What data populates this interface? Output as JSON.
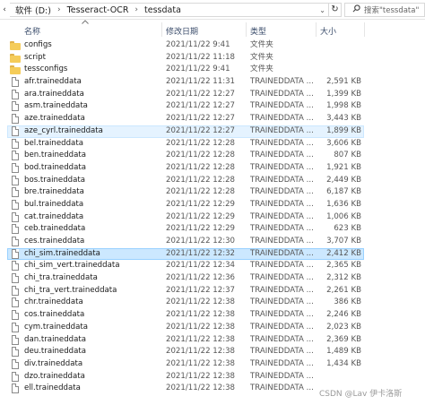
{
  "breadcrumb": {
    "items": [
      "软件 (D:)",
      "Tesseract-OCR",
      "tessdata"
    ],
    "back_arrow": "‹",
    "separator": "›",
    "dropdown": "⌄",
    "refresh_glyph": "↻"
  },
  "search": {
    "placeholder": "搜索\"tessdata\"",
    "icon": "search-icon"
  },
  "columns": {
    "name": "名称",
    "date": "修改日期",
    "type": "类型",
    "size": "大小"
  },
  "files": [
    {
      "name": "configs",
      "date": "2021/11/22 9:41",
      "type": "文件夹",
      "size": "",
      "kind": "folder"
    },
    {
      "name": "script",
      "date": "2021/11/22 11:18",
      "type": "文件夹",
      "size": "",
      "kind": "folder"
    },
    {
      "name": "tessconfigs",
      "date": "2021/11/22 9:41",
      "type": "文件夹",
      "size": "",
      "kind": "folder"
    },
    {
      "name": "afr.traineddata",
      "date": "2021/11/22 11:31",
      "type": "TRAINEDDATA ...",
      "size": "2,591 KB",
      "kind": "file"
    },
    {
      "name": "ara.traineddata",
      "date": "2021/11/22 12:27",
      "type": "TRAINEDDATA ...",
      "size": "1,399 KB",
      "kind": "file"
    },
    {
      "name": "asm.traineddata",
      "date": "2021/11/22 12:27",
      "type": "TRAINEDDATA ...",
      "size": "1,998 KB",
      "kind": "file"
    },
    {
      "name": "aze.traineddata",
      "date": "2021/11/22 12:27",
      "type": "TRAINEDDATA ...",
      "size": "3,443 KB",
      "kind": "file"
    },
    {
      "name": "aze_cyrl.traineddata",
      "date": "2021/11/22 12:27",
      "type": "TRAINEDDATA ...",
      "size": "1,899 KB",
      "kind": "file",
      "state": "hover"
    },
    {
      "name": "bel.traineddata",
      "date": "2021/11/22 12:28",
      "type": "TRAINEDDATA ...",
      "size": "3,606 KB",
      "kind": "file"
    },
    {
      "name": "ben.traineddata",
      "date": "2021/11/22 12:28",
      "type": "TRAINEDDATA ...",
      "size": "807 KB",
      "kind": "file"
    },
    {
      "name": "bod.traineddata",
      "date": "2021/11/22 12:28",
      "type": "TRAINEDDATA ...",
      "size": "1,921 KB",
      "kind": "file"
    },
    {
      "name": "bos.traineddata",
      "date": "2021/11/22 12:28",
      "type": "TRAINEDDATA ...",
      "size": "2,449 KB",
      "kind": "file"
    },
    {
      "name": "bre.traineddata",
      "date": "2021/11/22 12:28",
      "type": "TRAINEDDATA ...",
      "size": "6,187 KB",
      "kind": "file"
    },
    {
      "name": "bul.traineddata",
      "date": "2021/11/22 12:29",
      "type": "TRAINEDDATA ...",
      "size": "1,636 KB",
      "kind": "file"
    },
    {
      "name": "cat.traineddata",
      "date": "2021/11/22 12:29",
      "type": "TRAINEDDATA ...",
      "size": "1,006 KB",
      "kind": "file"
    },
    {
      "name": "ceb.traineddata",
      "date": "2021/11/22 12:29",
      "type": "TRAINEDDATA ...",
      "size": "623 KB",
      "kind": "file"
    },
    {
      "name": "ces.traineddata",
      "date": "2021/11/22 12:30",
      "type": "TRAINEDDATA ...",
      "size": "3,707 KB",
      "kind": "file"
    },
    {
      "name": "chi_sim.traineddata",
      "date": "2021/11/22 12:32",
      "type": "TRAINEDDATA ...",
      "size": "2,412 KB",
      "kind": "file",
      "state": "selected"
    },
    {
      "name": "chi_sim_vert.traineddata",
      "date": "2021/11/22 12:34",
      "type": "TRAINEDDATA ...",
      "size": "2,365 KB",
      "kind": "file"
    },
    {
      "name": "chi_tra.traineddata",
      "date": "2021/11/22 12:36",
      "type": "TRAINEDDATA ...",
      "size": "2,312 KB",
      "kind": "file"
    },
    {
      "name": "chi_tra_vert.traineddata",
      "date": "2021/11/22 12:37",
      "type": "TRAINEDDATA ...",
      "size": "2,261 KB",
      "kind": "file"
    },
    {
      "name": "chr.traineddata",
      "date": "2021/11/22 12:38",
      "type": "TRAINEDDATA ...",
      "size": "386 KB",
      "kind": "file"
    },
    {
      "name": "cos.traineddata",
      "date": "2021/11/22 12:38",
      "type": "TRAINEDDATA ...",
      "size": "2,246 KB",
      "kind": "file"
    },
    {
      "name": "cym.traineddata",
      "date": "2021/11/22 12:38",
      "type": "TRAINEDDATA ...",
      "size": "2,023 KB",
      "kind": "file"
    },
    {
      "name": "dan.traineddata",
      "date": "2021/11/22 12:38",
      "type": "TRAINEDDATA ...",
      "size": "2,369 KB",
      "kind": "file"
    },
    {
      "name": "deu.traineddata",
      "date": "2021/11/22 12:38",
      "type": "TRAINEDDATA ...",
      "size": "1,489 KB",
      "kind": "file"
    },
    {
      "name": "div.traineddata",
      "date": "2021/11/22 12:38",
      "type": "TRAINEDDATA ...",
      "size": "1,434 KB",
      "kind": "file"
    },
    {
      "name": "dzo.traineddata",
      "date": "2021/11/22 12:38",
      "type": "TRAINEDDATA ...",
      "size": "",
      "kind": "file"
    },
    {
      "name": "ell.traineddata",
      "date": "2021/11/22 12:38",
      "type": "TRAINEDDATA ...",
      "size": "",
      "kind": "file"
    }
  ],
  "watermark": "CSDN @Lav 伊卡洛斯",
  "colors": {
    "selected_bg": "#cce8ff",
    "hover_bg": "#e5f3ff",
    "folder": "#f5cc59",
    "header_text": "#3b4d6b"
  }
}
